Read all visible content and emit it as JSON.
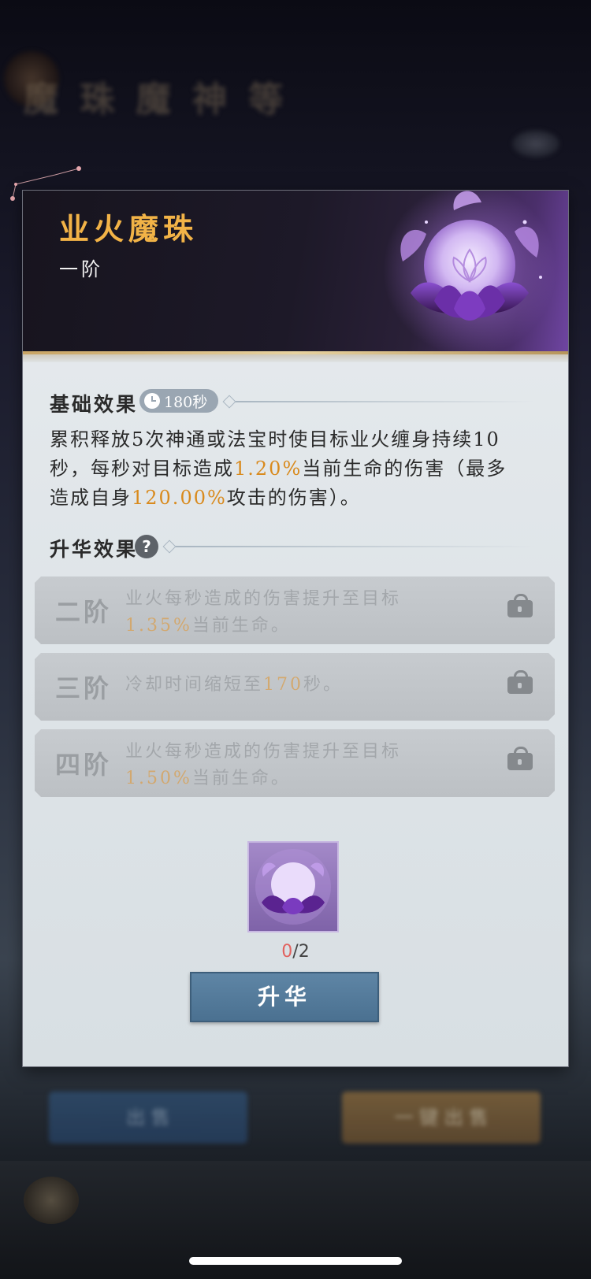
{
  "background": {
    "title": "魔 珠 魔 神 等",
    "bottom_left_button": "出 售",
    "bottom_right_button": "一 键 出 售"
  },
  "item": {
    "name": "业火魔珠",
    "tier": "一阶"
  },
  "base_effect": {
    "title": "基础效果",
    "cooldown": "180秒",
    "description_parts": {
      "p1": "累积释放5次神通或法宝时使目标业火缠身持续10秒，每秒对目标造成",
      "v1": "1.20%",
      "p2": "当前生命的伤害（最多造成自身",
      "v2": "120.00%",
      "p3": "攻击的伤害）。"
    }
  },
  "ascension": {
    "title": "升华效果",
    "help_symbol": "?",
    "tiers": [
      {
        "name": "二阶",
        "text_a": "业火每秒造成的伤害提升至目标",
        "value": "1.35%",
        "text_b": "当前生命。",
        "locked": true
      },
      {
        "name": "三阶",
        "text_a": "冷却时间缩短至",
        "value": "170",
        "text_b": "秒。",
        "locked": true
      },
      {
        "name": "四阶",
        "text_a": "业火每秒造成的伤害提升至目标",
        "value": "1.50%",
        "text_b": "当前生命。",
        "locked": true
      }
    ]
  },
  "cost": {
    "have": "0",
    "need": "/2"
  },
  "buttons": {
    "ascend": "升华"
  },
  "colors": {
    "title_gold": "#f2b347",
    "highlight": "#d98a1d",
    "button_blue": "#5f86a6",
    "orb_purple": "#8a55c8"
  }
}
